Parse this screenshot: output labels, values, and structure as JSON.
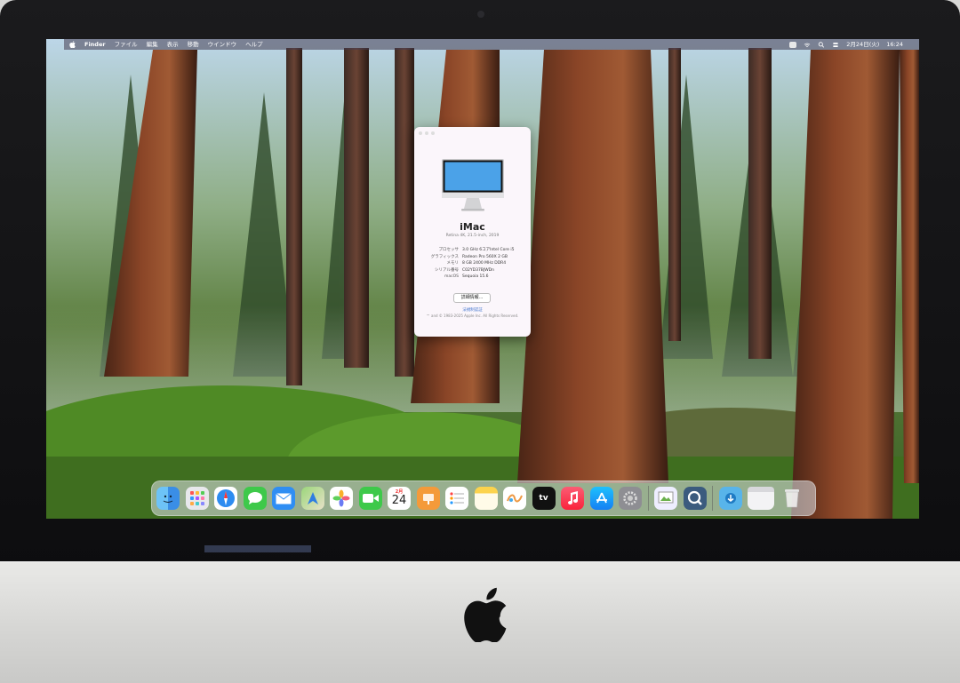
{
  "menubar": {
    "items": [
      "Finder",
      "ファイル",
      "編集",
      "表示",
      "移動",
      "ウインドウ",
      "ヘルプ"
    ],
    "date": "2月24日(火)",
    "time": "16:24"
  },
  "about_window": {
    "title": "iMac",
    "subtitle": "Retina 4K, 21.5-inch, 2019",
    "specs": [
      {
        "label": "プロセッサ",
        "value": "3.0 GHz 6コアIntel Core i5"
      },
      {
        "label": "グラフィックス",
        "value": "Radeon Pro 560X 2 GB"
      },
      {
        "label": "メモリ",
        "value": "8 GB 2400 MHz DDR4"
      },
      {
        "label": "シリアル番号",
        "value": "C02YD37BJWDn"
      },
      {
        "label": "macOS",
        "value": "Sequoia 15.6"
      }
    ],
    "more_info_button": "詳細情報...",
    "regulatory_link": "法規制認証",
    "copyright": "™ and © 1983-2025 Apple Inc. All Rights Reserved."
  },
  "dock": {
    "calendar_month": "2月",
    "calendar_day": "24",
    "apps": [
      "finder-icon",
      "launchpad-icon",
      "safari-icon",
      "messages-icon",
      "mail-icon",
      "maps-icon",
      "photos-icon",
      "facetime-icon",
      "calendar-icon",
      "keynote-icon",
      "reminders-icon",
      "notes-icon",
      "freeform-icon",
      "apple-tv-icon",
      "music-icon",
      "app-store-icon",
      "system-settings-icon",
      "preview-icon",
      "quicktime-icon",
      "downloads-folder-icon",
      "window-icon",
      "trash-icon"
    ]
  },
  "colors": {
    "accent": "#4a7bd0",
    "imac_screen": "#4ba2e8"
  }
}
